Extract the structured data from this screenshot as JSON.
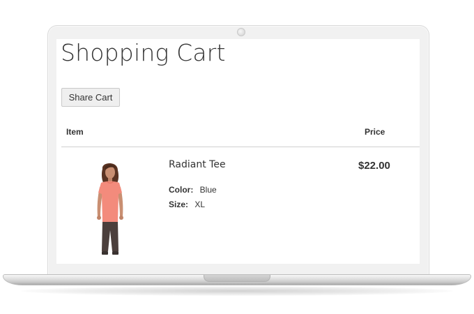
{
  "cart": {
    "title": "Shopping Cart",
    "share_button_label": "Share Cart",
    "columns": {
      "item": "Item",
      "price": "Price"
    },
    "items": [
      {
        "name": "Radiant Tee",
        "options": [
          {
            "label": "Color:",
            "value": "Blue"
          },
          {
            "label": "Size:",
            "value": "XL"
          }
        ],
        "price": "$22.00",
        "image": "product-photo"
      }
    ]
  },
  "colors": {
    "accent_text": "#333333",
    "tee": "#f38b7c",
    "pants": "#4b3f3c"
  }
}
